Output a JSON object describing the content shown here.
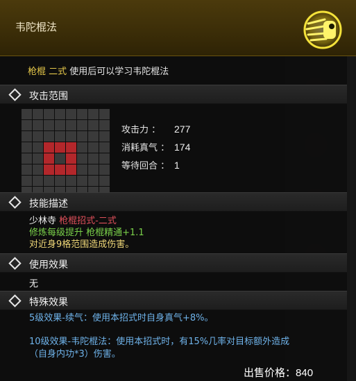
{
  "header": {
    "title": "韦陀棍法"
  },
  "intro": {
    "weapon": "枪棍 二式",
    "text": " 使用后可以学习韦陀棍法"
  },
  "sections": {
    "attack_range": "攻击范围",
    "skill_desc": "技能描述",
    "use_effect": "使用效果",
    "special_effect": "特殊效果"
  },
  "range_grid": {
    "size": 8,
    "active_cells": [
      [
        3,
        2
      ],
      [
        3,
        3
      ],
      [
        3,
        4
      ],
      [
        4,
        2
      ],
      [
        4,
        4
      ],
      [
        5,
        2
      ],
      [
        5,
        3
      ],
      [
        5,
        4
      ]
    ]
  },
  "stats": [
    {
      "label": "攻击力 ：",
      "value": "277"
    },
    {
      "label": "消耗真气 ：",
      "value": "174"
    },
    {
      "label": "等待回合 ：",
      "value": "1"
    }
  ],
  "description": {
    "sect": "少林寺 ",
    "style": "枪棍招式-二式",
    "training": "修炼每级提升 枪棍精通+1.1",
    "effect": "对近身9格范围造成伤害。"
  },
  "use_effect": "无",
  "special_effects": {
    "line1": "5级效果-续气：使用本招式时自身真气+8%。",
    "line2a": "10级效果-韦陀棍法：使用本招式时，有15%几率对目标额外造成",
    "line2b": "（自身内功*3）伤害。"
  },
  "price": {
    "label": "出售价格：",
    "value": "840"
  },
  "colors": {
    "header": "#4b3a0c",
    "grid_active": "#b3272b",
    "special_text": "#6fb3ea"
  }
}
